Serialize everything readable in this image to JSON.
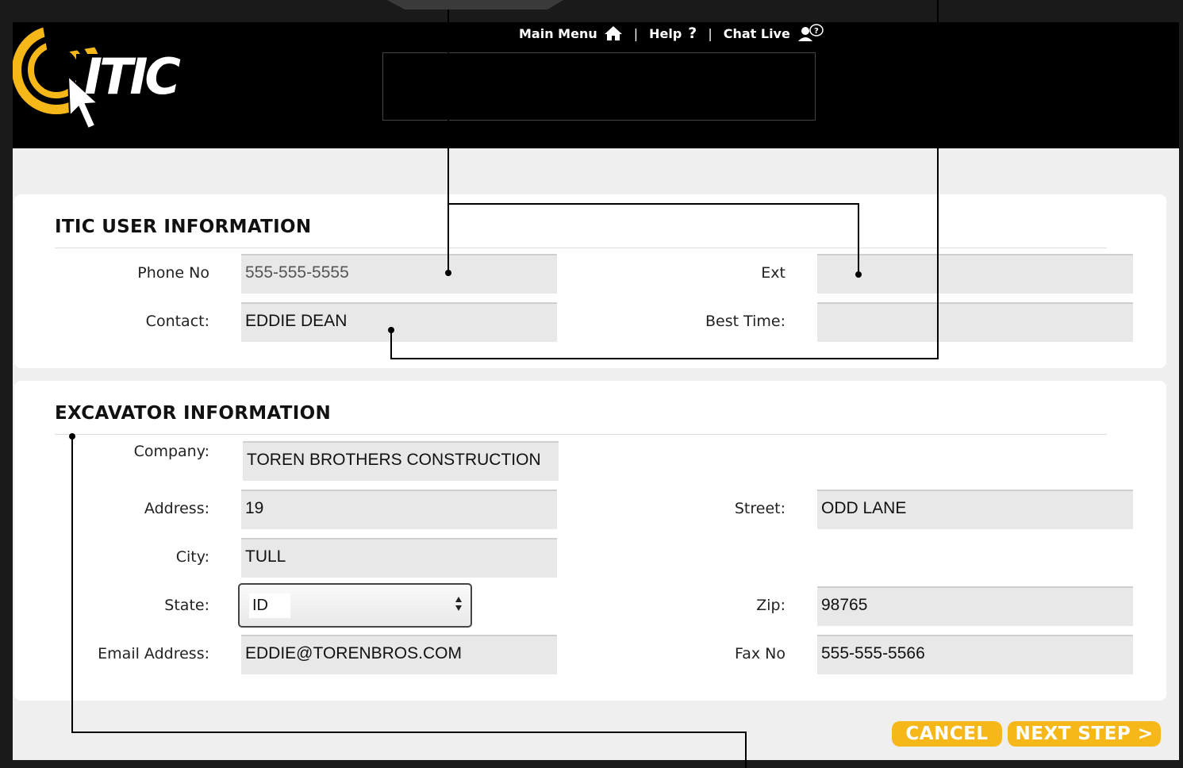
{
  "colors": {
    "accent": "#f6b718",
    "header_background": "#000000",
    "page_background": "#efefef",
    "panel_background": "#ffffff",
    "input_background": "#e8e8e8"
  },
  "header": {
    "logo_text": "ITIC",
    "nav": [
      {
        "label": "Main Menu",
        "icon": "home-icon"
      },
      {
        "label": "Help",
        "icon": "question-icon"
      },
      {
        "label": "Chat Live",
        "icon": "chat-agent-icon"
      }
    ],
    "separator": "|"
  },
  "user_info": {
    "title": "ITIC USER INFORMATION",
    "phone_label": "Phone No",
    "phone_placeholder": "555-555-5555",
    "phone_value": "",
    "ext_label": "Ext",
    "ext_value": "",
    "contact_label": "Contact:",
    "contact_value": "EDDIE DEAN",
    "best_time_label": "Best Time:",
    "best_time_value": ""
  },
  "excavator_info": {
    "title": "EXCAVATOR INFORMATION",
    "company_label": "Company:",
    "company_value": "TOREN BROTHERS CONSTRUCTION",
    "address_label": "Address:",
    "address_value": "19",
    "street_label": "Street:",
    "street_value": "ODD LANE",
    "city_label": "City:",
    "city_value": "TULL",
    "state_label": "State:",
    "state_value": "ID",
    "zip_label": "Zip:",
    "zip_value": "98765",
    "email_label": "Email Address:",
    "email_value": "EDDIE@TORENBROS.COM",
    "fax_label": "Fax No",
    "fax_value": "555-555-5566"
  },
  "actions": {
    "cancel_label": "CANCEL",
    "next_label": "NEXT STEP >"
  }
}
